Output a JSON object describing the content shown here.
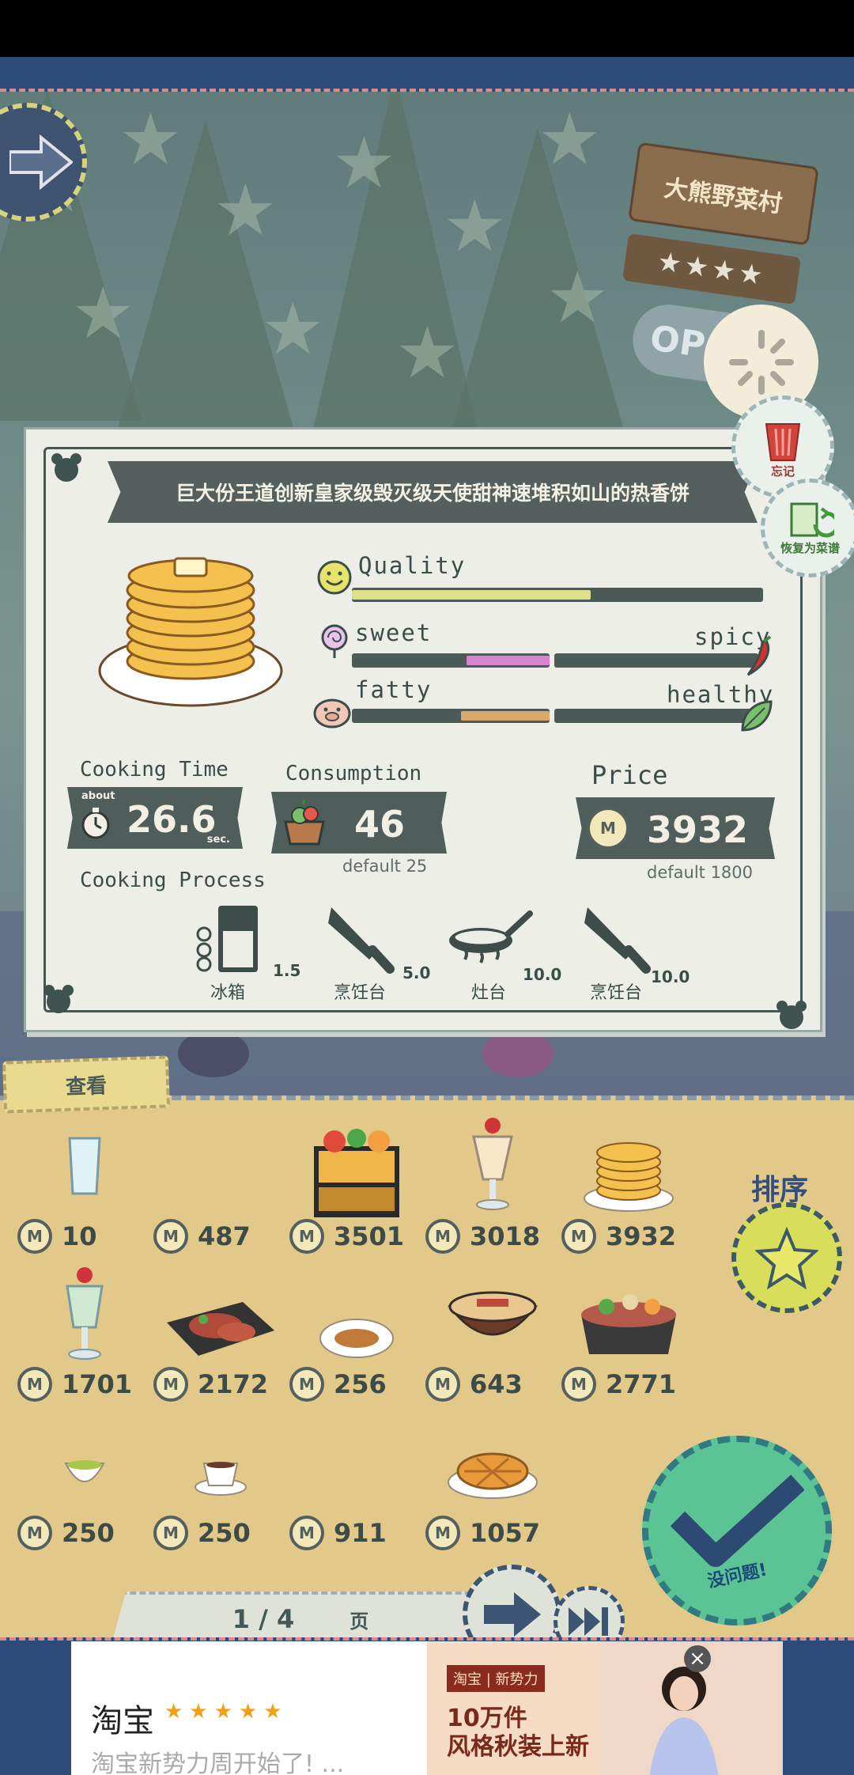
{
  "shop": {
    "sign_name": "大熊野菜村",
    "rating_stars": "★★★★",
    "open_label": "OP"
  },
  "side_buttons": {
    "forget_label": "忘记",
    "restore_label": "恢复为菜谱"
  },
  "recipe": {
    "title": "巨大份王道创新皇家级毁灭级天使甜神速堆积如山的热香饼",
    "stats": {
      "quality": {
        "label": "Quality",
        "value": 0.58
      },
      "taste": {
        "left_label": "sweet",
        "right_label": "spicy",
        "value": 0.42
      },
      "nutrition": {
        "left_label": "fatty",
        "right_label": "healthy",
        "value": 0.45
      }
    },
    "cooking_time": {
      "label": "Cooking Time",
      "prefix": "about",
      "value": "26.6",
      "unit": "sec."
    },
    "consumption": {
      "label": "Consumption",
      "value": "46",
      "default": "default 25"
    },
    "price": {
      "label": "Price",
      "value": "3932",
      "default": "default 1800"
    },
    "process": {
      "label": "Cooking Process",
      "steps": [
        {
          "name": "冰箱",
          "time": "1.5",
          "icon": "fridge-icon"
        },
        {
          "name": "烹饪台",
          "time": "5.0",
          "icon": "knife-icon"
        },
        {
          "name": "灶台",
          "time": "10.0",
          "icon": "pan-icon"
        },
        {
          "name": "烹饪台",
          "time": "10.0",
          "icon": "knife-icon"
        }
      ]
    }
  },
  "list": {
    "view_tab": "查看",
    "sort_label": "排序",
    "confirm_label": "没问题!",
    "coin_symbol": "M",
    "items": [
      {
        "price": "10",
        "icon": "water-glass-icon"
      },
      {
        "price": "487",
        "icon": "empty-slot"
      },
      {
        "price": "3501",
        "icon": "bento-box-icon"
      },
      {
        "price": "3018",
        "icon": "parfait-icon"
      },
      {
        "price": "3932",
        "icon": "pancake-icon"
      },
      {
        "price": "1701",
        "icon": "float-drink-icon"
      },
      {
        "price": "2172",
        "icon": "steak-plate-icon"
      },
      {
        "price": "256",
        "icon": "bread-plate-icon"
      },
      {
        "price": "643",
        "icon": "ramen-bowl-icon"
      },
      {
        "price": "2771",
        "icon": "sukiyaki-pot-icon"
      },
      {
        "price": "250",
        "icon": "green-tea-icon"
      },
      {
        "price": "250",
        "icon": "coffee-cup-icon"
      },
      {
        "price": "911",
        "icon": "empty-slot"
      },
      {
        "price": "1057",
        "icon": "pie-icon"
      }
    ],
    "pager": {
      "current": "1 / 4",
      "unit": "页"
    }
  },
  "ad": {
    "title": "淘宝",
    "stars": "★★★★★",
    "subtitle": "淘宝新势力周开始了! ...",
    "brand": "淘宝 | 新势力",
    "headline_1": "10万件",
    "headline_2": "风格秋装上新"
  },
  "colors": {
    "card_bg": "#edeee8",
    "panel_bg": "#e3c989",
    "dark_slate": "#4f5e5b",
    "quality_fill": "#dce08a",
    "sweet_fill": "#d884d0",
    "fatty_fill": "#d9a86a"
  }
}
